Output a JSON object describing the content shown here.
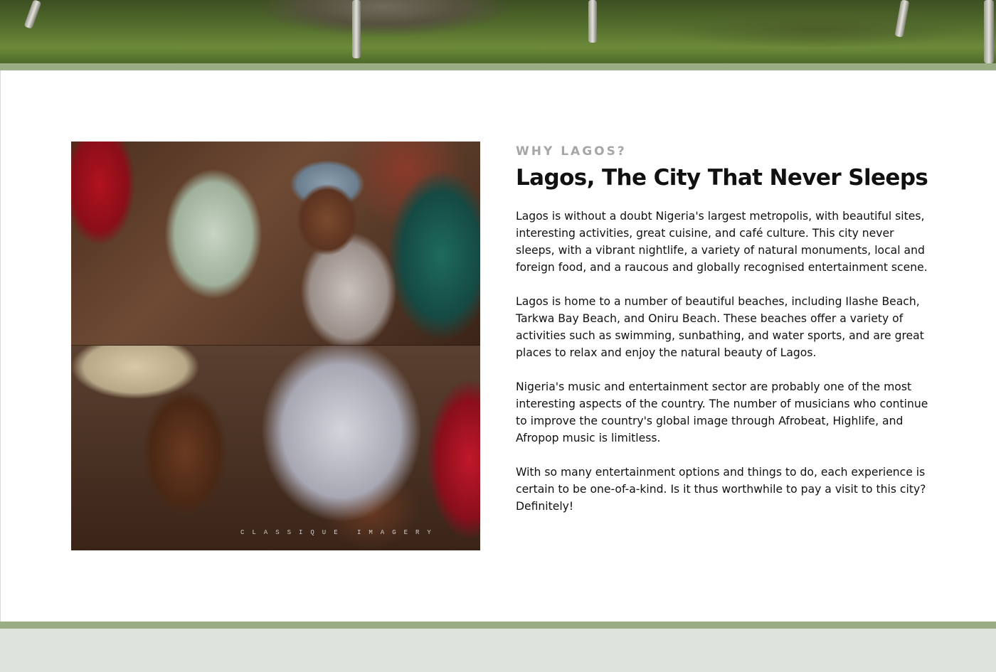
{
  "hero": {
    "image": "park-lawn-hero-image"
  },
  "about": {
    "eyebrow": "WHY LAGOS?",
    "title": "Lagos, The City That Never Sleeps",
    "paragraphs": [
      "Lagos is without a doubt Nigeria's largest metropolis, with beautiful sites, interesting activities, great cuisine, and café culture. This city never sleeps, with a vibrant nightlife, a variety of natural monuments, local and foreign food, and a raucous and globally recognised entertainment scene.",
      "Lagos is home to a number of beautiful beaches, including Ilashe Beach, Tarkwa Bay Beach, and Oniru Beach. These beaches offer a variety of activities such as swimming, sunbathing, and water sports, and are great places to relax and enjoy the natural beauty of Lagos.",
      "Nigeria's music and entertainment sector are probably one of the most interesting aspects of the country. The number of musicians who continue to improve the country's global image through Afrobeat, Highlife, and Afropop music is limitless.",
      "With so many entertainment options and things to do, each experience is certain to be one-of-a-kind. Is it thus worthwhile to pay a visit to this city? Definitely!"
    ],
    "photo": {
      "watermark": "CLASSIQUE IMAGERY"
    }
  },
  "colors": {
    "accent_bar": "#9aac84",
    "footer_bg": "#dfe3de",
    "eyebrow": "#a6a6a6",
    "text": "#111111"
  }
}
